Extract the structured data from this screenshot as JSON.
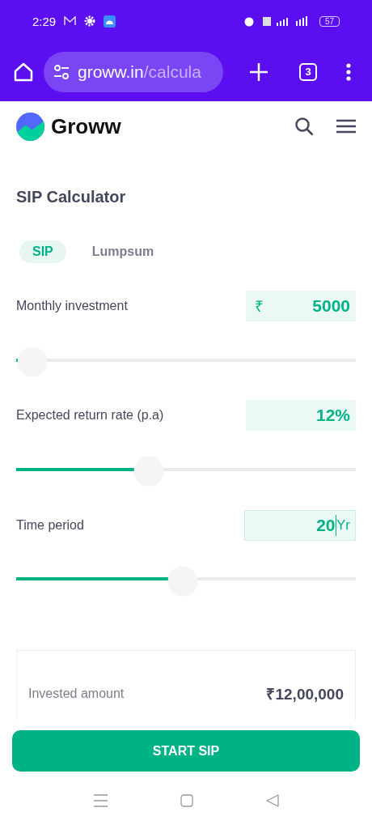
{
  "status_bar": {
    "time": "2:29",
    "battery": "57"
  },
  "browser": {
    "url_host": "groww.in",
    "url_path": "/calcula",
    "tab_count": "3"
  },
  "site": {
    "brand": "Groww"
  },
  "calculator": {
    "title": "SIP Calculator",
    "tabs": [
      {
        "label": "SIP",
        "selected": true
      },
      {
        "label": "Lumpsum",
        "selected": false
      }
    ],
    "inputs": [
      {
        "label": "Monthly investment",
        "prefix": "₹",
        "value": "5000",
        "level": 0.005,
        "focused": false
      },
      {
        "label": "Expected return rate (p.a)",
        "value": "12",
        "suffix": "%",
        "level": 0.38,
        "focused": false
      },
      {
        "label": "Time period",
        "value": "20",
        "suffix": "Yr",
        "level": 0.49,
        "focused": true
      }
    ],
    "results": [
      {
        "label": "Invested amount",
        "value": "₹12,00,000"
      }
    ]
  },
  "action": {
    "label": "START SIP"
  }
}
